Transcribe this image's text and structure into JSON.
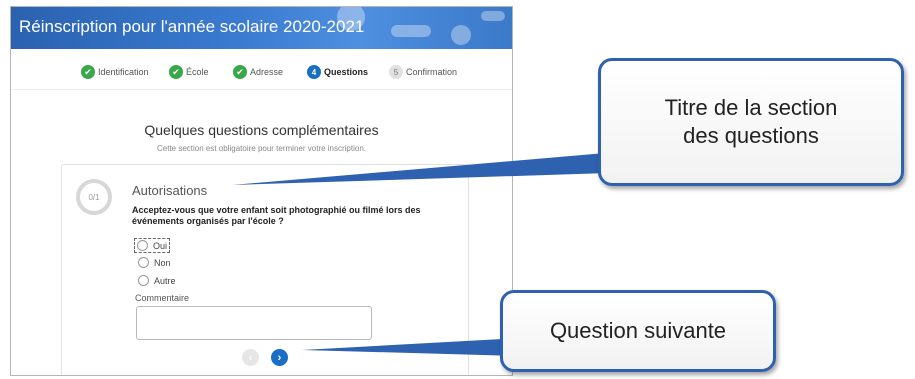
{
  "window": {
    "title": "Réinscription pour l'année scolaire 2020-2021"
  },
  "steps": [
    {
      "label": "Identification",
      "state": "done"
    },
    {
      "label": "École",
      "state": "done"
    },
    {
      "label": "Adresse",
      "state": "done"
    },
    {
      "label": "Questions",
      "number": "4",
      "state": "active"
    },
    {
      "label": "Confirmation",
      "number": "5",
      "state": "pending"
    }
  ],
  "section": {
    "title": "Quelques questions complémentaires",
    "subtitle": "Cette section est obligatoire pour terminer votre inscription."
  },
  "question": {
    "progress": "0/1",
    "group": "Autorisations",
    "text": "Acceptez-vous que votre enfant soit photographié ou filmé lors des événements organisés par l'école ?",
    "options": [
      "Oui",
      "Non",
      "Autre"
    ],
    "comment_label": "Commentaire",
    "comment_value": ""
  },
  "callouts": {
    "section_title_line1": "Titre de la section",
    "section_title_line2": "des questions",
    "next_question": "Question suivante"
  },
  "colors": {
    "accent": "#1a6fc4",
    "success": "#3aa84a",
    "callout_border": "#2e61b0"
  }
}
